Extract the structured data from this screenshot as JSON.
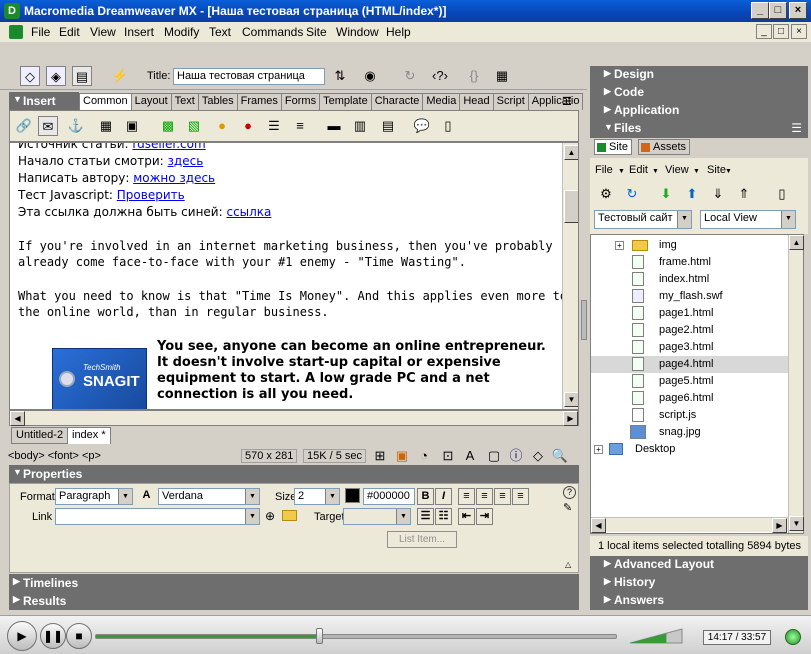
{
  "window": {
    "title": "Macromedia Dreamweaver MX - [Наша тестовая страница (HTML/index*)]",
    "min_label": "_",
    "max_label": "□",
    "close_label": "×"
  },
  "menu": [
    "File",
    "Edit",
    "View",
    "Insert",
    "Modify",
    "Text",
    "Commands",
    "Site",
    "Window",
    "Help"
  ],
  "doc_toolbar": {
    "title_label": "Title:",
    "title_value": "Наша тестовая страница"
  },
  "insert_bar": {
    "heading": "Insert",
    "tabs": [
      "Common",
      "Layout",
      "Text",
      "Tables",
      "Frames",
      "Forms",
      "Template",
      "Characte",
      "Media",
      "Head",
      "Script",
      "Applicatio"
    ],
    "active_tab": "Common"
  },
  "editor": {
    "lines": [
      {
        "text": "Источник статьи: ",
        "link": "rdseller.com"
      },
      {
        "text": "Начало статьи смотри: ",
        "link": "здесь"
      },
      {
        "text": "Написать автору: ",
        "link": "можно здесь"
      },
      {
        "text": "Тест Javascript: ",
        "link": "Проверить"
      },
      {
        "text": "Эта ссылка должна быть синей: ",
        "link": "ссылка"
      }
    ],
    "para1_l1": "If you're involved in an internet marketing business, then you've probably",
    "para1_l2": "already come face-to-face with your #1 enemy - \"Time Wasting\".",
    "para2_l1": "What you need to know is that \"Time Is Money\". And this applies even more to",
    "para2_l2": "the online world, than in regular business.",
    "bold_l1": "You see, anyone can become an online entrepreneur.",
    "bold_l2": "It doesn't involve start-up capital or expensive",
    "bold_l3": "equipment to start. A low grade PC and a net",
    "bold_l4": "connection is all you need.",
    "image_label_1": "TechSmith",
    "image_label_2": "SNAGIT"
  },
  "doc_tabs": [
    "Untitled-2",
    "index *"
  ],
  "status": {
    "tag_path": "<body> <font> <p>",
    "window_size": "570 x 281",
    "download": "15K / 5 sec"
  },
  "properties": {
    "heading": "Properties",
    "format_label": "Format",
    "format_value": "Paragraph",
    "font_value": "Verdana",
    "size_label": "Size",
    "size_value": "2",
    "color_value": "#000000",
    "link_label": "Link",
    "target_label": "Target",
    "list_item_button": "List Item..."
  },
  "bottom_panels": [
    "Timelines",
    "Results"
  ],
  "right_panels": {
    "top": [
      "Design",
      "Code",
      "Application",
      "Files"
    ],
    "files_tabs": [
      "Site",
      "Assets"
    ],
    "files_menu": [
      "File",
      "Edit",
      "View",
      "Site"
    ],
    "site_select": "Тестовый сайт",
    "view_select": "Local View",
    "files": [
      {
        "name": "img",
        "type": "folder"
      },
      {
        "name": "frame.html",
        "type": "html"
      },
      {
        "name": "index.html",
        "type": "html"
      },
      {
        "name": "my_flash.swf",
        "type": "swf"
      },
      {
        "name": "page1.html",
        "type": "html"
      },
      {
        "name": "page2.html",
        "type": "html"
      },
      {
        "name": "page3.html",
        "type": "html"
      },
      {
        "name": "page4.html",
        "type": "html",
        "selected": true
      },
      {
        "name": "page5.html",
        "type": "html"
      },
      {
        "name": "page6.html",
        "type": "html"
      },
      {
        "name": "script.js",
        "type": "js"
      },
      {
        "name": "snag.jpg",
        "type": "jpg"
      }
    ],
    "desktop_label": "Desktop",
    "status": "1 local items selected totalling 5894 bytes",
    "bottom": [
      "Advanced Layout",
      "History",
      "Answers"
    ]
  },
  "player": {
    "time": "14:17 / 33:57",
    "progress": 0.43,
    "volume": 0.7
  },
  "colors": {
    "titlebar": "#0846b8",
    "panel_header": "#6e6e6e",
    "link": "#0000ee"
  }
}
